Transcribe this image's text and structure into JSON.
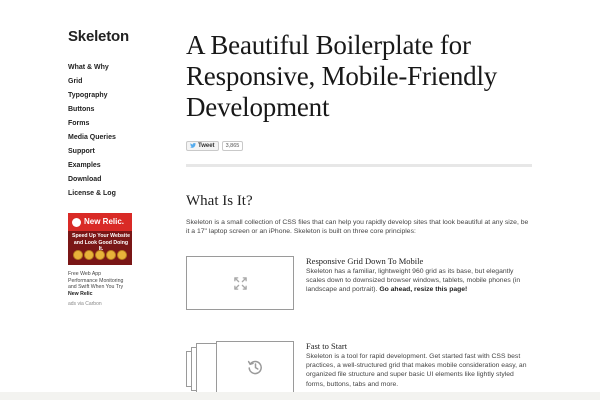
{
  "sidebar": {
    "brand": "Skeleton",
    "nav": [
      "What & Why",
      "Grid",
      "Typography",
      "Buttons",
      "Forms",
      "Media Queries",
      "Support",
      "Examples",
      "Download",
      "License & Log"
    ],
    "ad": {
      "title": "New Relic.",
      "tagline": "Speed Up Your Website and Look Good Doing It.",
      "caption": "Free Web App Performance Monitoring and Swift When You Try",
      "caption_link": "New Relic",
      "via": "ads via Carbon"
    }
  },
  "main": {
    "title": "A Beautiful Boilerplate for Responsive, Mobile-Friendly Development",
    "tweet_label": "Tweet",
    "tweet_count": "3,865",
    "section_title": "What Is It?",
    "intro": "Skeleton is a small collection of CSS files that can help you rapidly develop sites that look beautiful at any size, be it a 17\" laptop screen or an iPhone. Skeleton is built on three core principles:",
    "features": [
      {
        "heading": "Responsive Grid Down To Mobile",
        "body": "Skeleton has a familiar, lightweight 960 grid as its base, but elegantly scales down to downsized browser windows, tablets, mobile phones (in landscape and portrait). ",
        "link": "Go ahead, resize this page!"
      },
      {
        "heading": "Fast to Start",
        "body": "Skeleton is a tool for rapid development. Get started fast with CSS best practices, a well-structured grid that makes mobile consideration easy, an organized file structure and super basic UI elements like lightly styled forms, buttons, tabs and more."
      }
    ]
  },
  "colors": {
    "accent": "#d92a26",
    "divider": "#e7e7e7",
    "box_border": "#9a9a9a"
  }
}
